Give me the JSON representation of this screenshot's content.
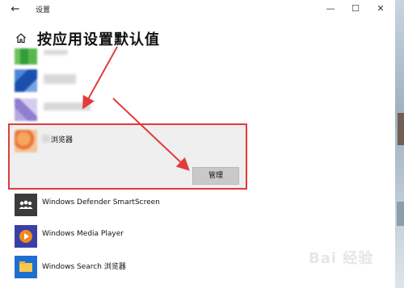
{
  "window": {
    "title": "设置",
    "back_icon": "back-arrow-icon",
    "controls": {
      "minimize": "—",
      "maximize": "☐",
      "close": "✕"
    }
  },
  "page": {
    "home_icon": "home-icon",
    "title": "按应用设置默认值"
  },
  "apps": [
    {
      "name": "",
      "tile": "green",
      "blurred": true
    },
    {
      "name": "",
      "tile": "blue",
      "blurred": true
    },
    {
      "name": "",
      "tile": "purple",
      "blurred": true
    },
    {
      "name": "浏览器",
      "tile": "orange",
      "blurred": true,
      "selected": true,
      "button": "管理"
    },
    {
      "name": "Windows Defender SmartScreen",
      "tile": "defender"
    },
    {
      "name": "Windows Media Player",
      "tile": "wmp"
    },
    {
      "name": "Windows Search 浏览器",
      "tile": "search"
    }
  ],
  "annotation": {
    "color": "#e23b3b"
  },
  "watermark": "Bai 经验"
}
